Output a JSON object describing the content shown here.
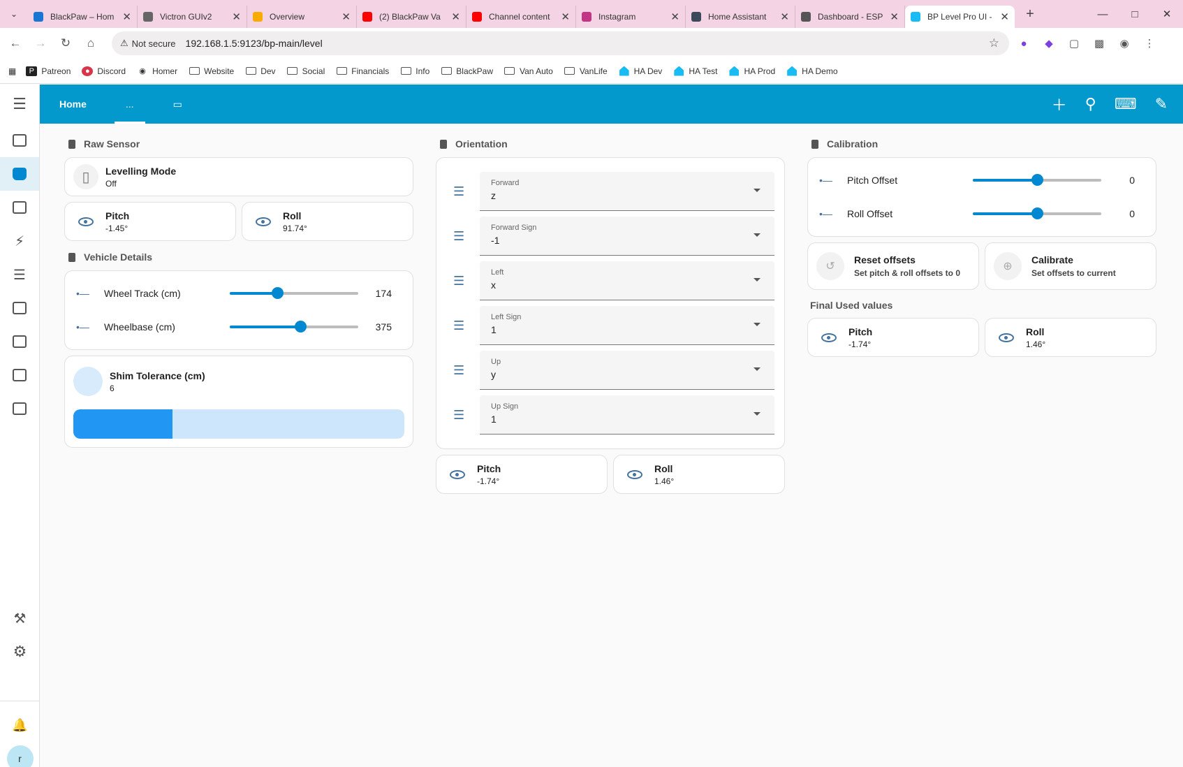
{
  "browser": {
    "tabs": [
      {
        "label": "BlackPaw – Hom",
        "color": "#1976d2"
      },
      {
        "label": "Victron GUIv2",
        "color": "#666666"
      },
      {
        "label": "Overview",
        "color": "#f9ab00"
      },
      {
        "label": "(2) BlackPaw Va",
        "color": "#ff0000"
      },
      {
        "label": "Channel content",
        "color": "#ff0000"
      },
      {
        "label": "Instagram",
        "color": "#c13584"
      },
      {
        "label": "Home Assistant",
        "color": "#3a4a5a"
      },
      {
        "label": "Dashboard - ESP",
        "color": "#555555"
      },
      {
        "label": "BP Level Pro UI -",
        "color": "#18bcf2",
        "active": true
      }
    ],
    "security": "Not secure",
    "url": "192.168.1.5:9123/bp-main/level",
    "bookmarks": [
      "Patreon",
      "Discord",
      "Homer",
      "Website",
      "Dev",
      "Social",
      "Financials",
      "Info",
      "BlackPaw",
      "Van Auto",
      "VanLife",
      "HA Dev",
      "HA Test",
      "HA Prod",
      "HA Demo"
    ]
  },
  "header": {
    "tabs": [
      "Home",
      "...",
      "▭"
    ],
    "accent": "#0399cc"
  },
  "sidebar": {
    "avatar_letter": "r"
  },
  "raw_sensor": {
    "title": "Raw Sensor",
    "levelling": {
      "name": "Levelling Mode",
      "value": "Off"
    },
    "pitch": {
      "name": "Pitch",
      "value": "-1.45°"
    },
    "roll": {
      "name": "Roll",
      "value": "91.74°"
    }
  },
  "vehicle": {
    "title": "Vehicle Details",
    "sliders": [
      {
        "label": "Wheel Track (cm)",
        "value": "174",
        "fraction": 0.37
      },
      {
        "label": "Wheelbase (cm)",
        "value": "375",
        "fraction": 0.55
      }
    ],
    "shim": {
      "name": "Shim Tolerance (cm)",
      "value": "6",
      "fraction": 0.3
    }
  },
  "orientation": {
    "title": "Orientation",
    "selects": [
      {
        "label": "Forward",
        "value": "z"
      },
      {
        "label": "Forward Sign",
        "value": "-1"
      },
      {
        "label": "Left",
        "value": "x"
      },
      {
        "label": "Left Sign",
        "value": "1"
      },
      {
        "label": "Up",
        "value": "y"
      },
      {
        "label": "Up Sign",
        "value": "1"
      }
    ],
    "pitch": {
      "name": "Pitch",
      "value": "-1.74°"
    },
    "roll": {
      "name": "Roll",
      "value": "1.46°"
    }
  },
  "calibration": {
    "title": "Calibration",
    "sliders": [
      {
        "label": "Pitch Offset",
        "value": "0",
        "fraction": 0.5
      },
      {
        "label": "Roll Offset",
        "value": "0",
        "fraction": 0.5
      }
    ],
    "reset": {
      "name": "Reset offsets",
      "sub": "Set pitch & roll offsets to 0"
    },
    "calibrate": {
      "name": "Calibrate",
      "sub": "Set offsets to current"
    },
    "final_title": "Final Used values",
    "pitch": {
      "name": "Pitch",
      "value": "-1.74°"
    },
    "roll": {
      "name": "Roll",
      "value": "1.46°"
    }
  }
}
